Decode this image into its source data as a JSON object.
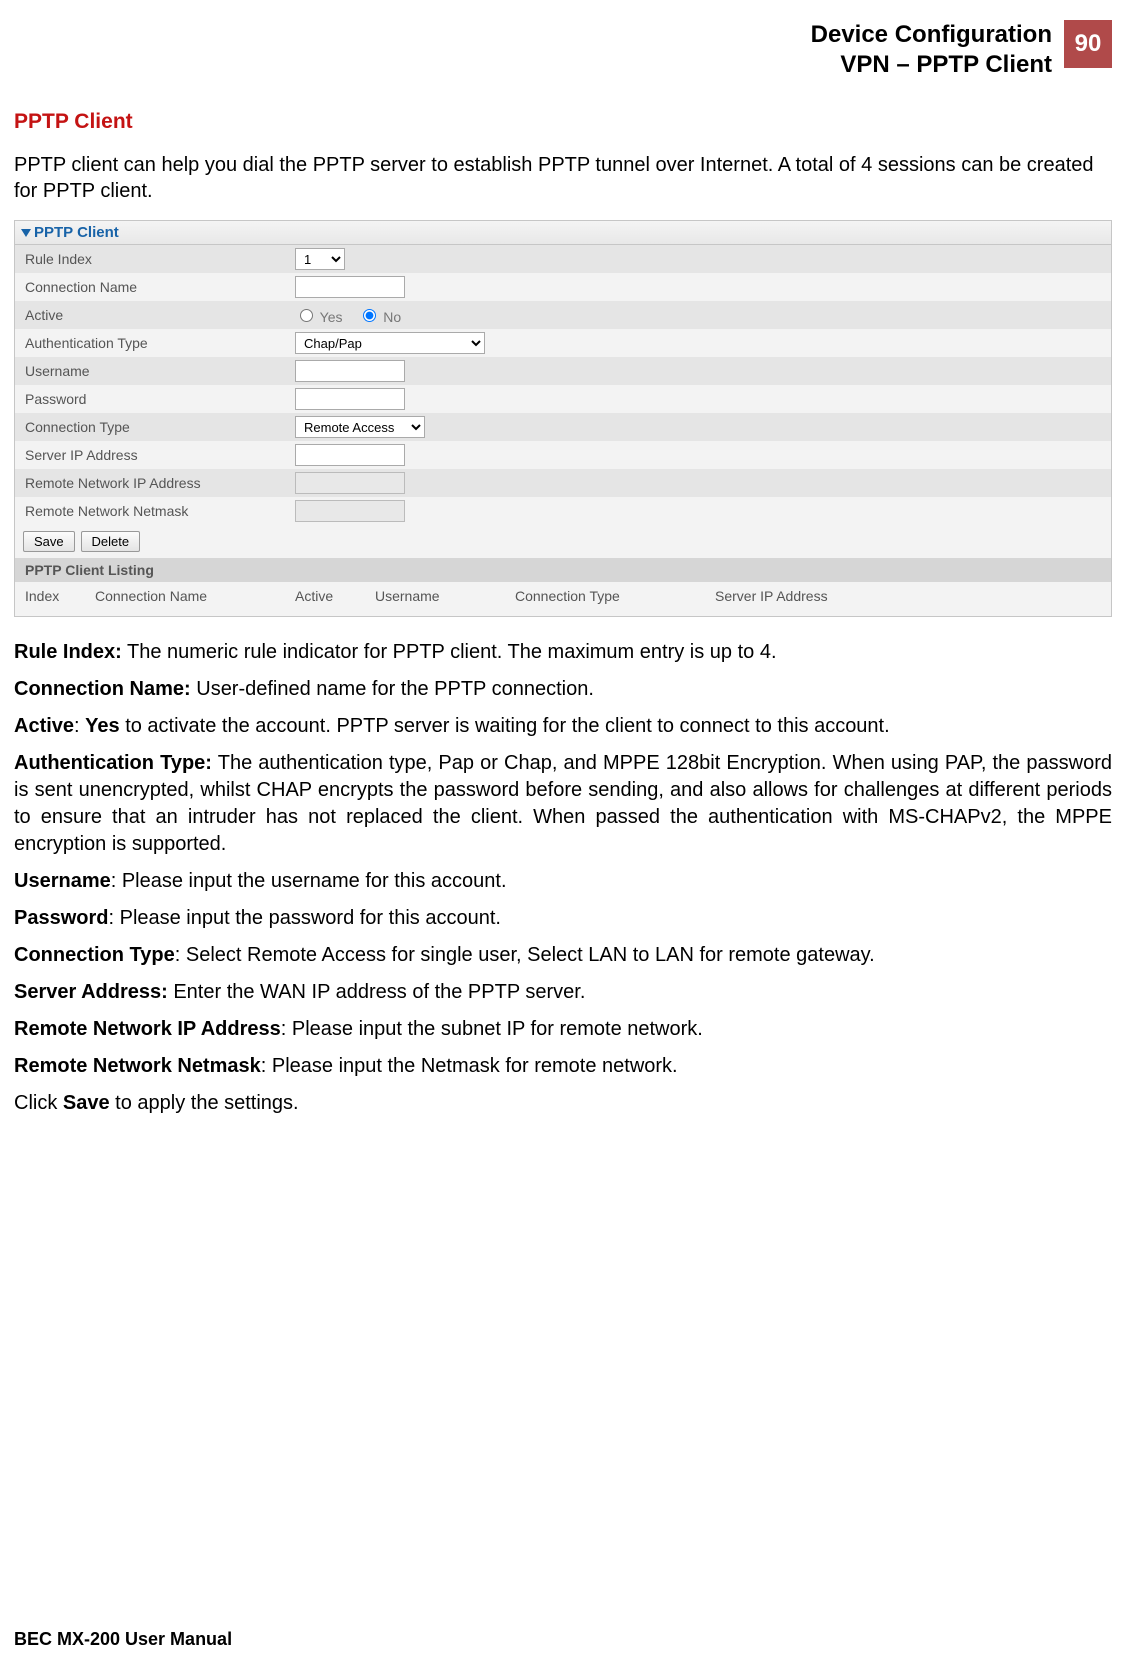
{
  "header": {
    "line1": "Device Configuration",
    "line2": "VPN – PPTP Client",
    "page_number": "90"
  },
  "section_title": "PPTP Client",
  "intro": "PPTP client can help you dial the PPTP server to establish PPTP tunnel over Internet. A total of 4 sessions can be created for PPTP client.",
  "panel": {
    "title": "PPTP Client",
    "rows": {
      "rule_index_label": "Rule Index",
      "rule_index_value": "1",
      "connection_name_label": "Connection Name",
      "connection_name_value": "",
      "active_label": "Active",
      "active_yes": "Yes",
      "active_no": "No",
      "auth_type_label": "Authentication Type",
      "auth_type_value": "Chap/Pap",
      "username_label": "Username",
      "username_value": "",
      "password_label": "Password",
      "password_value": "",
      "conn_type_label": "Connection Type",
      "conn_type_value": "Remote Access",
      "server_ip_label": "Server IP Address",
      "server_ip_value": "",
      "remote_ip_label": "Remote Network IP Address",
      "remote_ip_value": "",
      "remote_mask_label": "Remote Network Netmask",
      "remote_mask_value": ""
    },
    "buttons": {
      "save": "Save",
      "delete": "Delete"
    },
    "listing": {
      "title": "PPTP Client Listing",
      "cols": {
        "index": "Index",
        "conn_name": "Connection Name",
        "active": "Active",
        "username": "Username",
        "conn_type": "Connection Type",
        "server_ip": "Server IP Address"
      }
    }
  },
  "defs": {
    "rule_index_b": "Rule Index:",
    "rule_index_t": " The numeric rule indicator for PPTP client.  The maximum entry is up to 4.",
    "conn_name_b": "Connection Name:",
    "conn_name_t": " User-defined name for the PPTP connection.",
    "active_b": "Active",
    "active_sep": ": ",
    "active_b2": "Yes",
    "active_t": " to activate the account. PPTP server is waiting for the client to connect to this account.",
    "auth_b": "Authentication Type:",
    "auth_t": " The authentication type, Pap or Chap, and MPPE 128bit Encryption. When using PAP, the password is sent unencrypted, whilst CHAP encrypts the password before sending, and also allows for challenges at different periods to ensure that an intruder has not replaced the client. When passed the authentication with MS-CHAPv2, the MPPE encryption is supported.",
    "user_b": "Username",
    "user_t": ": Please input the username for this account.",
    "pass_b": "Password",
    "pass_t": ": Please input the password for this account.",
    "ctype_b": "Connection Type",
    "ctype_t": ": Select Remote Access for single user, Select LAN to LAN for remote gateway.",
    "srv_b": "Server Address:",
    "srv_t": " Enter the WAN IP address of the PPTP server.",
    "rip_b": "Remote Network IP Address",
    "rip_t": ": Please input the subnet IP for remote network.",
    "rmask_b": "Remote Network Netmask",
    "rmask_t": ": Please input the Netmask for remote network.",
    "save_pre": "Click ",
    "save_b": "Save",
    "save_post": " to apply the settings."
  },
  "footer": "BEC MX-200 User Manual"
}
